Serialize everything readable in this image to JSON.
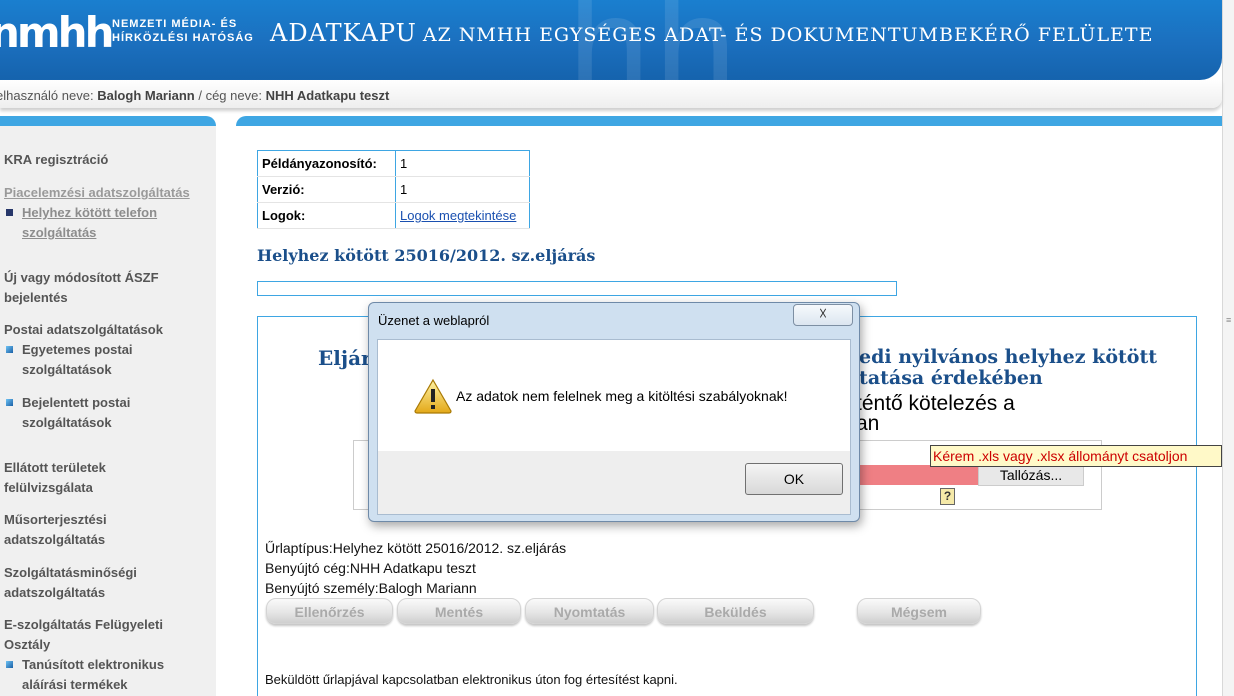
{
  "header": {
    "logo_mark": "nmhh",
    "logo_line1": "NEMZETI MÉDIA- ÉS",
    "logo_line2": "HÍRKÖZLÉSI HATÓSÁG",
    "app_title": "ADATKAPU",
    "app_subtitle": "AZ NMHH EGYSÉGES ADAT- ÉS DOKUMENTUMBEKÉRŐ FELÜLETE"
  },
  "userbar": {
    "user_prefix": "elhasználó neve:",
    "user_name": "Balogh Mariann",
    "company_prefix": "/ cég neve:",
    "company_name": "NHH Adatkapu teszt"
  },
  "sidebar": {
    "kra": "KRA regisztráció",
    "piac": "Piacelemzési adatszolgáltatás",
    "helyhez1": "Helyhez kötött telefon",
    "helyhez2": "szolgáltatás",
    "aszf1": "Új vagy módosított ÁSZF",
    "aszf2": "bejelentés",
    "postai": "Postai adatszolgáltatások",
    "egyetemes1": "Egyetemes postai",
    "egyetemes2": "szolgáltatások",
    "bejelentett1": "Bejelentett postai",
    "bejelentett2": "szolgáltatások",
    "ellatott1": "Ellátott területek",
    "ellatott2": "felülvizsgálata",
    "musor1": "Műsorterjesztési",
    "musor2": "adatszolgáltatás",
    "minoseg1": "Szolgáltatásminőségi",
    "minoseg2": "adatszolgáltatás",
    "eszolg1": "E-szolgáltatás Felügyeleti",
    "eszolg2": "Osztály",
    "tanus1": "Tanúsított elektronikus",
    "tanus2": "aláírási termékek"
  },
  "info": {
    "id_label": "Példányazonosító:",
    "id_value": "1",
    "version_label": "Verzió:",
    "version_value": "1",
    "logs_label": "Logok:",
    "logs_link": "Logok megtekintése"
  },
  "procedure_title": "Helyhez kötött 25016/2012. sz.eljárás",
  "form": {
    "heading_left": "Eljár",
    "heading_right1": "yedi nyilvános helyhez kötött",
    "heading_right2": "ytatása érdekében",
    "body_right1": "téntő kötelezés a",
    "body_right2": "an",
    "tooltip": "Kérem .xls vagy .xlsx állományt csatoljon",
    "browse": "Tallózás...",
    "help": "?"
  },
  "meta": {
    "type_label": "Űrlaptípus:",
    "type_value": "Helyhez kötött 25016/2012. sz.eljárás",
    "company_label": "Benyújtó cég:",
    "company_value": "NHH Adatkapu teszt",
    "person_label": "Benyújtó személy:",
    "person_value": "Balogh Mariann"
  },
  "actions": {
    "check": "Ellenőrzés",
    "save": "Mentés",
    "print": "Nyomtatás",
    "submit": "Beküldés",
    "cancel": "Mégsem"
  },
  "notice": "Beküldött űrlapjával kapcsolatban elektronikus úton fog értesítést kapni.",
  "dialog": {
    "title": "Üzenet a weblapról",
    "close": "☓",
    "message": "Az adatok nem felelnek meg a kitöltési szabályoknak!",
    "ok": "OK"
  }
}
